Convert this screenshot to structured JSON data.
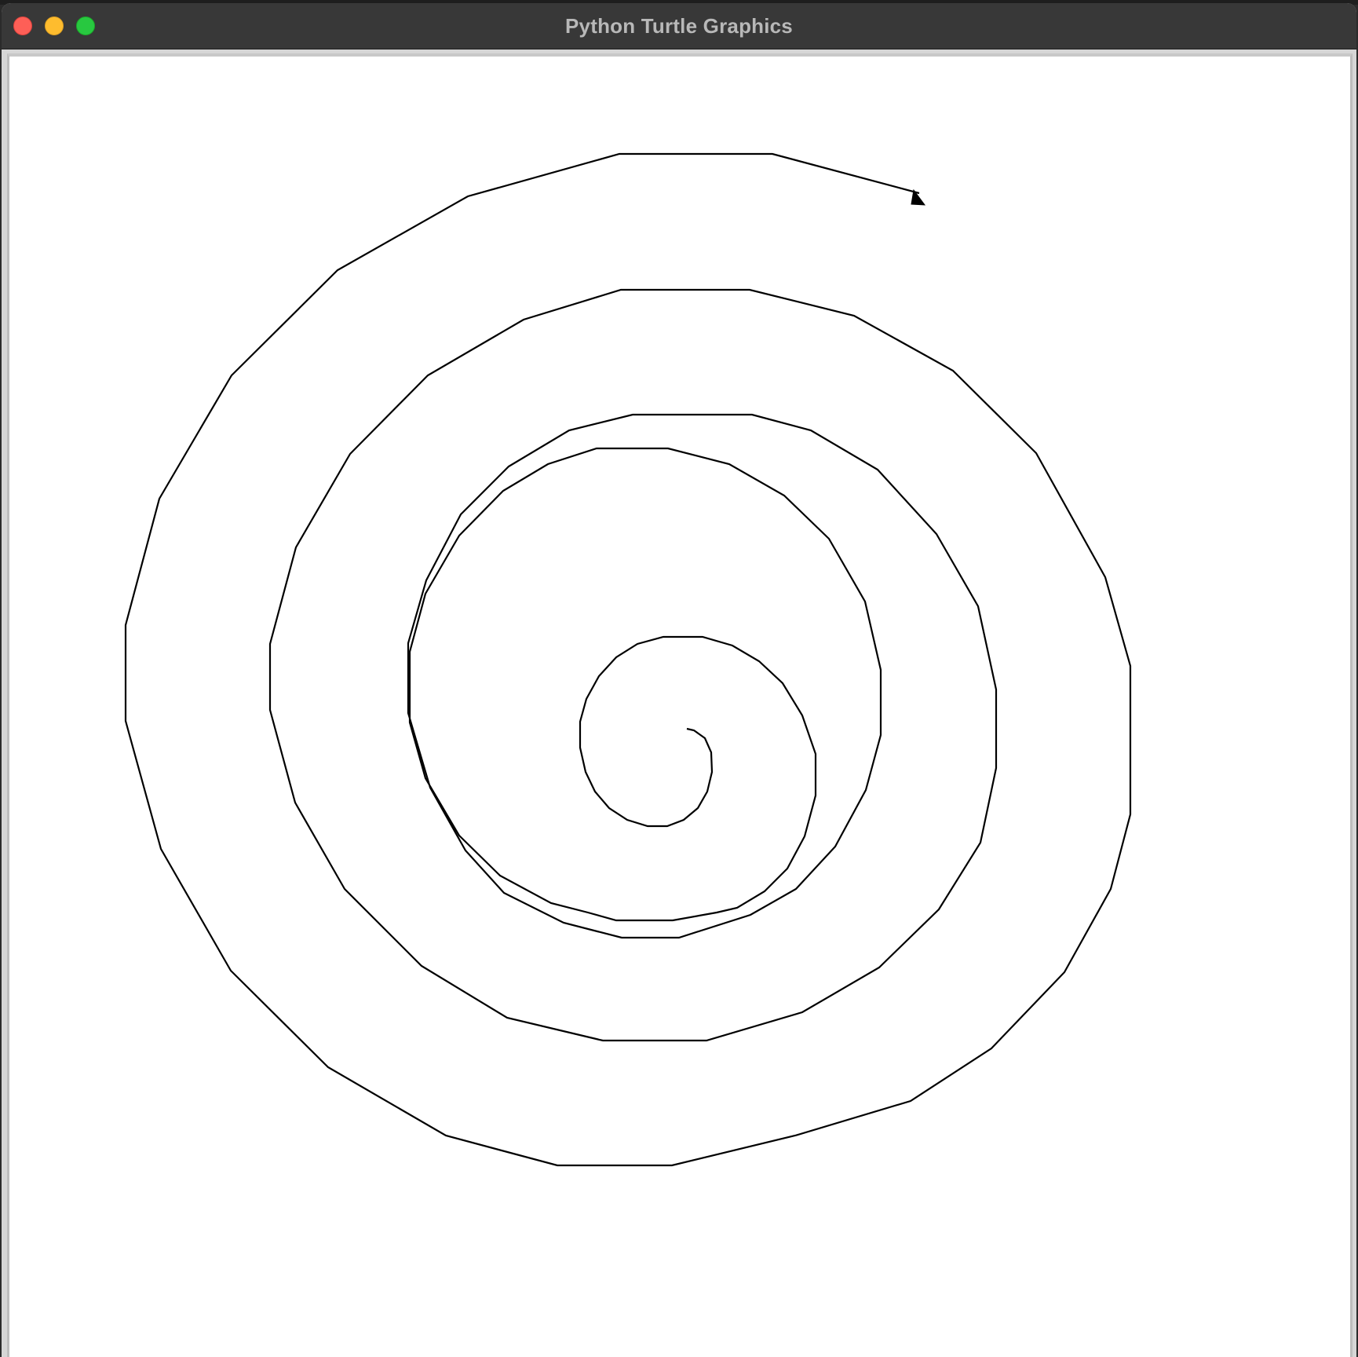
{
  "window": {
    "title": "Python Turtle Graphics"
  },
  "canvas": {
    "background": "#ffffff",
    "pen_color": "#000000",
    "shape": "spiral",
    "turtle_shape": "classic-arrow"
  },
  "icons": {
    "close": "close-traffic-light",
    "minimize": "minimize-traffic-light",
    "zoom": "zoom-traffic-light"
  }
}
